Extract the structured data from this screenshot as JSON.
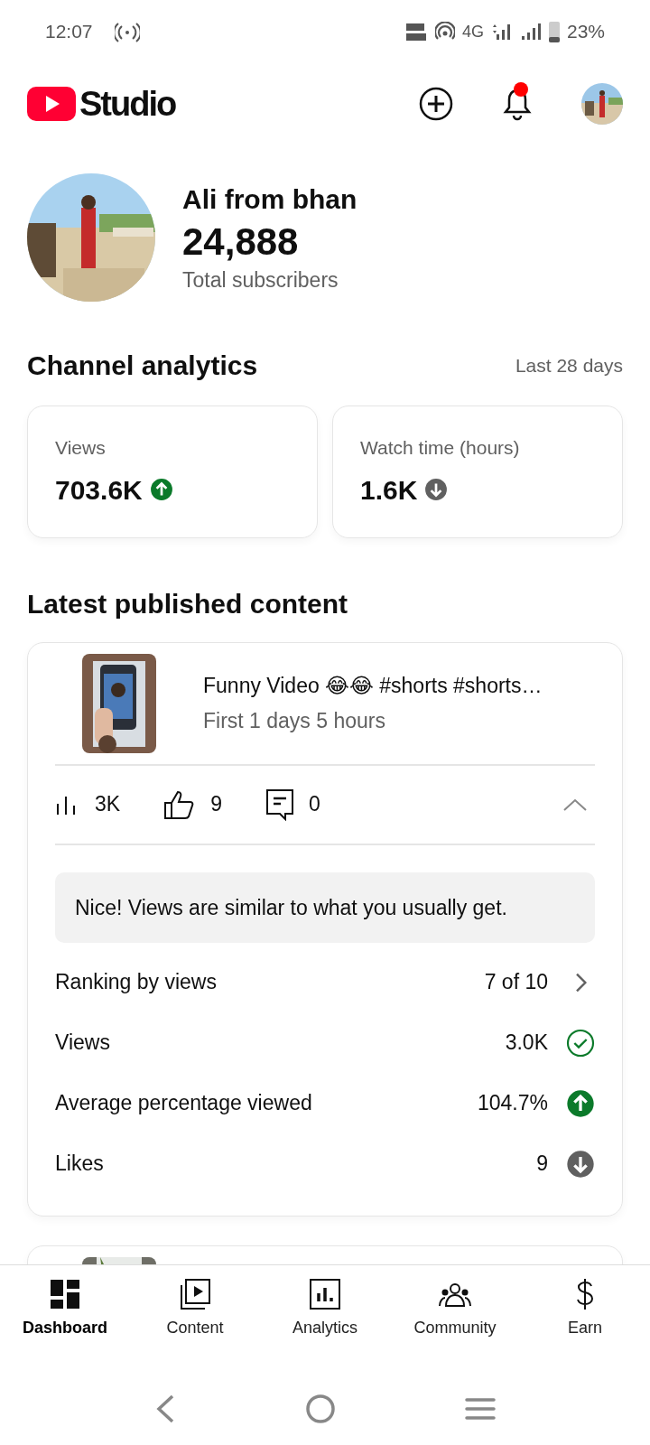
{
  "status_bar": {
    "time": "12:07",
    "network": "4G",
    "battery": "23%"
  },
  "header": {
    "logo_text": "Studio",
    "notification_dot": true
  },
  "channel": {
    "name": "Ali from bhan",
    "subscribers": "24,888",
    "subscribers_label": "Total subscribers"
  },
  "analytics": {
    "title": "Channel analytics",
    "period": "Last 28 days",
    "cards": [
      {
        "label": "Views",
        "value": "703.6K",
        "kind": "up"
      },
      {
        "label": "Watch time (hours)",
        "value": "1.6K",
        "kind": "down"
      }
    ]
  },
  "latest": {
    "title": "Latest published content",
    "video": {
      "title": "Funny Video 😂😂 #shorts #shorts…",
      "subtitle": "First 1 days 5 hours",
      "views": "3K",
      "likes": "9",
      "comments": "0",
      "expanded": true,
      "note": "Nice! Views are similar to what you usually get.",
      "metrics": [
        {
          "label": "Ranking by views",
          "value": "7 of 10",
          "kind": "chevron"
        },
        {
          "label": "Views",
          "value": "3.0K",
          "kind": "check"
        },
        {
          "label": "Average percentage viewed",
          "value": "104.7%",
          "kind": "up"
        },
        {
          "label": "Likes",
          "value": "9",
          "kind": "down"
        }
      ]
    }
  },
  "bottom_nav": [
    {
      "label": "Dashboard",
      "selected": true,
      "kind": "dashboard"
    },
    {
      "label": "Content",
      "selected": false,
      "kind": "content"
    },
    {
      "label": "Analytics",
      "selected": false,
      "kind": "analytics"
    },
    {
      "label": "Community",
      "selected": false,
      "kind": "community"
    },
    {
      "label": "Earn",
      "selected": false,
      "kind": "earn"
    }
  ]
}
